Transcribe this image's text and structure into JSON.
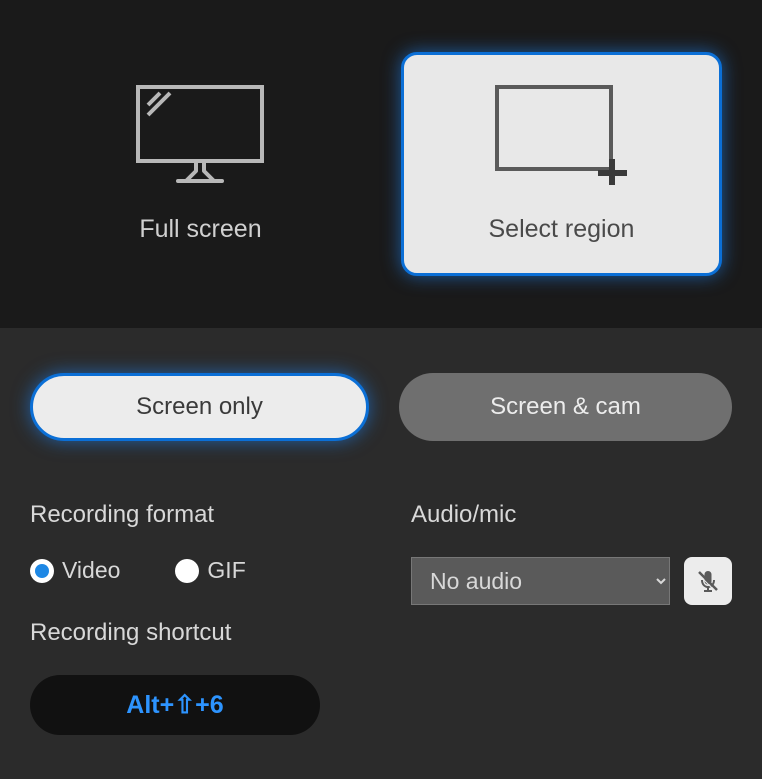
{
  "capture_area": {
    "full_screen": {
      "label": "Full screen"
    },
    "select_region": {
      "label": "Select region"
    }
  },
  "modes": {
    "screen_only": "Screen only",
    "screen_cam": "Screen & cam"
  },
  "recording_format": {
    "label": "Recording format",
    "video": "Video",
    "gif": "GIF"
  },
  "audio": {
    "label": "Audio/mic",
    "selected": "No audio"
  },
  "shortcut": {
    "label": "Recording shortcut",
    "keys": "Alt+⇧+6"
  }
}
